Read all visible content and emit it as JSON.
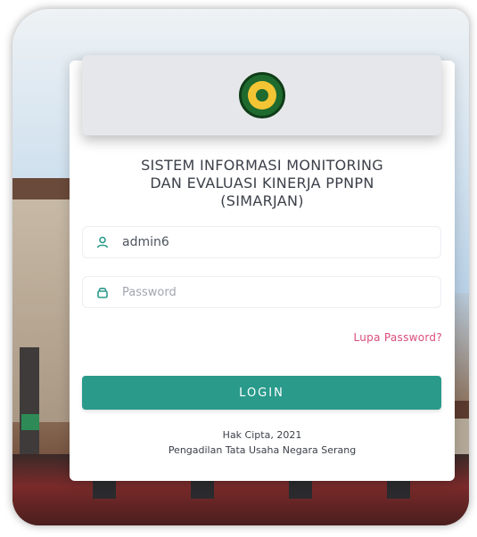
{
  "app": {
    "title_lines": [
      "SISTEM INFORMASI MONITORING",
      "DAN EVALUASI KINERJA PPNPN",
      "(SIMARJAN)"
    ]
  },
  "login": {
    "username_value": "admin6",
    "password_placeholder": "Password",
    "forgot_password_label": "Lupa Password?",
    "login_button_label": "LOGIN"
  },
  "footer": {
    "copyright": "Hak Cipta, 2021",
    "organization": "Pengadilan Tata Usaha Negara Serang"
  },
  "icons": {
    "username": "user-icon",
    "password": "lock-icon",
    "logo": "court-emblem-logo"
  },
  "colors": {
    "accent": "#2a9a8b",
    "icon": "#2a9a8b",
    "link": "#d94d7a"
  }
}
